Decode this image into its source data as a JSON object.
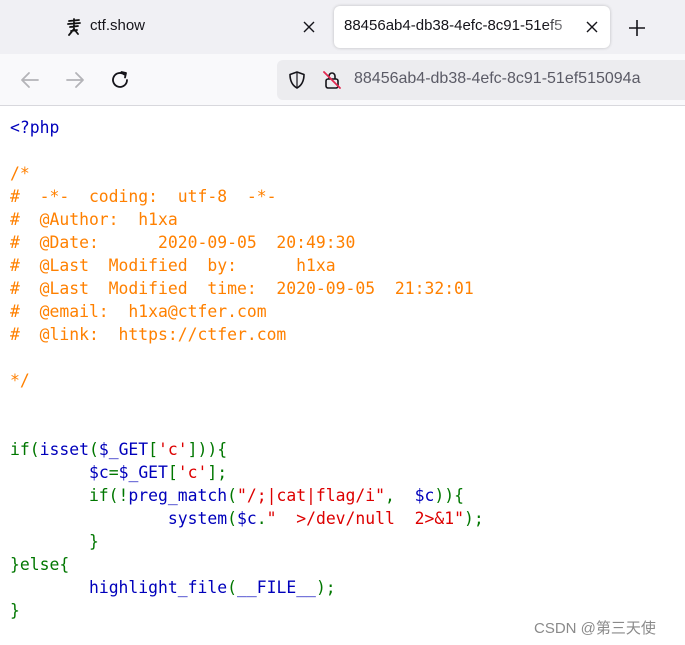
{
  "tabs": [
    {
      "label": "ctf.show",
      "favicon": "ctfshow-logo-icon"
    },
    {
      "label": "88456ab4-db38-4efc-8c91-51ef5",
      "active": true
    }
  ],
  "toolbar": {
    "url": "88456ab4-db38-4efc-8c91-51ef515094a"
  },
  "code_lines": [
    [
      {
        "t": "<?php",
        "c": "def"
      }
    ],
    [],
    [
      {
        "t": "/*",
        "c": "com"
      }
    ],
    [
      {
        "t": "#  -*-  coding:  utf-8  -*-",
        "c": "com"
      }
    ],
    [
      {
        "t": "#  @Author:  h1xa",
        "c": "com"
      }
    ],
    [
      {
        "t": "#  @Date:      2020-09-05  20:49:30",
        "c": "com"
      }
    ],
    [
      {
        "t": "#  @Last  Modified  by:      h1xa",
        "c": "com"
      }
    ],
    [
      {
        "t": "#  @Last  Modified  time:  2020-09-05  21:32:01",
        "c": "com"
      }
    ],
    [
      {
        "t": "#  @email:  h1xa@ctfer.com",
        "c": "com"
      }
    ],
    [
      {
        "t": "#  @link:  https://ctfer.com",
        "c": "com"
      }
    ],
    [],
    [
      {
        "t": "*/",
        "c": "com"
      }
    ],
    [],
    [],
    [
      {
        "t": "if(",
        "c": "kw"
      },
      {
        "t": "isset",
        "c": "def"
      },
      {
        "t": "(",
        "c": "kw"
      },
      {
        "t": "$_GET",
        "c": "def"
      },
      {
        "t": "[",
        "c": "kw"
      },
      {
        "t": "'c'",
        "c": "str"
      },
      {
        "t": "])){",
        "c": "kw"
      }
    ],
    [
      {
        "t": "        ",
        "c": "kw"
      },
      {
        "t": "$c",
        "c": "def"
      },
      {
        "t": "=",
        "c": "kw"
      },
      {
        "t": "$_GET",
        "c": "def"
      },
      {
        "t": "[",
        "c": "kw"
      },
      {
        "t": "'c'",
        "c": "str"
      },
      {
        "t": "];",
        "c": "kw"
      }
    ],
    [
      {
        "t": "        if(!",
        "c": "kw"
      },
      {
        "t": "preg_match",
        "c": "def"
      },
      {
        "t": "(",
        "c": "kw"
      },
      {
        "t": "\"/;|cat|flag/i\"",
        "c": "str"
      },
      {
        "t": ",  ",
        "c": "kw"
      },
      {
        "t": "$c",
        "c": "def"
      },
      {
        "t": ")){",
        "c": "kw"
      }
    ],
    [
      {
        "t": "                ",
        "c": "kw"
      },
      {
        "t": "system",
        "c": "def"
      },
      {
        "t": "(",
        "c": "kw"
      },
      {
        "t": "$c",
        "c": "def"
      },
      {
        "t": ".",
        "c": "kw"
      },
      {
        "t": "\"  >/dev/null  2>&1\"",
        "c": "str"
      },
      {
        "t": ");",
        "c": "kw"
      }
    ],
    [
      {
        "t": "        }",
        "c": "kw"
      }
    ],
    [
      {
        "t": "}else{",
        "c": "kw"
      }
    ],
    [
      {
        "t": "        ",
        "c": "kw"
      },
      {
        "t": "highlight_file",
        "c": "def"
      },
      {
        "t": "(",
        "c": "kw"
      },
      {
        "t": "__FILE__",
        "c": "def"
      },
      {
        "t": ");",
        "c": "kw"
      }
    ],
    [
      {
        "t": "}",
        "c": "kw"
      }
    ]
  ],
  "watermark": "CSDN @第三天使",
  "colors": {
    "default": "#0000bb",
    "comment": "#ff8000",
    "keyword": "#007700",
    "string": "#dd0000"
  },
  "icons": [
    "ctfshow-logo-icon",
    "close-icon",
    "plus-icon",
    "arrow-left-icon",
    "arrow-right-icon",
    "reload-icon",
    "shield-icon",
    "lock-slash-icon"
  ]
}
